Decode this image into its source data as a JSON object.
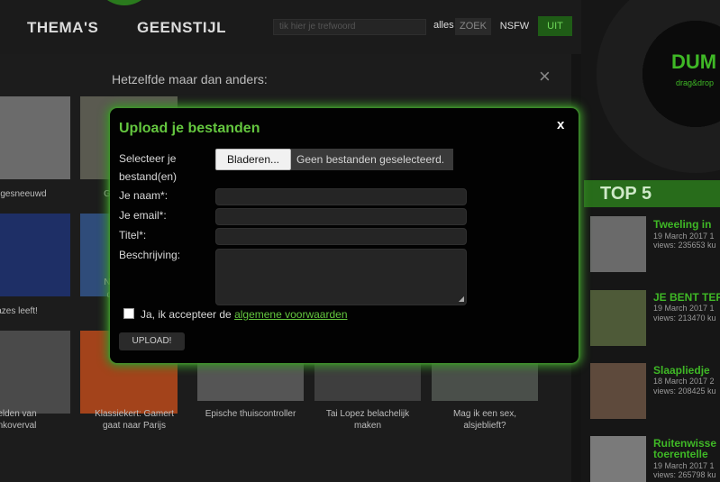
{
  "nav": {
    "thema": "THEMA'S",
    "geenstijl": "GEENSTIJL",
    "search_placeholder": "tik hier je trefwoord",
    "alles": "alles",
    "zoek": "ZOEK",
    "nsfw": "NSFW",
    "uit": "UIT"
  },
  "side": {
    "dump": "DUM",
    "dragdrop": "drag&drop",
    "top5": "TOP 5",
    "items": [
      {
        "title": "Tweeling in",
        "date": "19 March 2017 1",
        "views": "views: 235653 ku"
      },
      {
        "title": "JE BENT TER",
        "date": "19 March 2017 1",
        "views": "views: 213470 ku"
      },
      {
        "title": "Slaapliedje",
        "date": "18 March 2017 2",
        "views": "views: 208425 ku"
      },
      {
        "title": "Ruitenwisse",
        "title2": "toerentelle",
        "date": "19 March 2017 1",
        "views": "views: 265798 ku"
      }
    ]
  },
  "panel": {
    "title": "Hetzelfde maar dan anders:",
    "close": "×",
    "captions": [
      {
        "text": "eft gesneeuwd"
      },
      {
        "text": "G"
      },
      {
        "text": "azes leeft!"
      },
      {
        "text": "Neder"
      },
      {
        "text": "de"
      },
      {
        "text": "elden van"
      },
      {
        "text": "nkoverval"
      },
      {
        "text": "Klassiekert: Gamert"
      },
      {
        "text": "gaat naar Parijs"
      },
      {
        "text": "Epische thuiscontroller"
      },
      {
        "text": "Tai Lopez belachelijk"
      },
      {
        "text": "maken"
      },
      {
        "text": "Mag ik een sex,"
      },
      {
        "text": "alsjeblieft?"
      }
    ]
  },
  "modal": {
    "title": "Upload je bestanden",
    "close": "x",
    "select_label_1": "Selecteer je",
    "select_label_2": "bestand(en)",
    "browse": "Bladeren...",
    "no_file": "Geen bestanden geselecteerd.",
    "name_label": "Je naam*:",
    "email_label": "Je email*:",
    "title_label": "Titel*:",
    "desc_label": "Beschrijving:",
    "agree_text": "Ja, ik accepteer de",
    "agree_link": "algemene voorwaarden",
    "upload": "UPLOAD!"
  },
  "colors": {
    "accent": "#64c63f",
    "glow": "#3b8e29",
    "top5_bg": "#286c1b"
  }
}
